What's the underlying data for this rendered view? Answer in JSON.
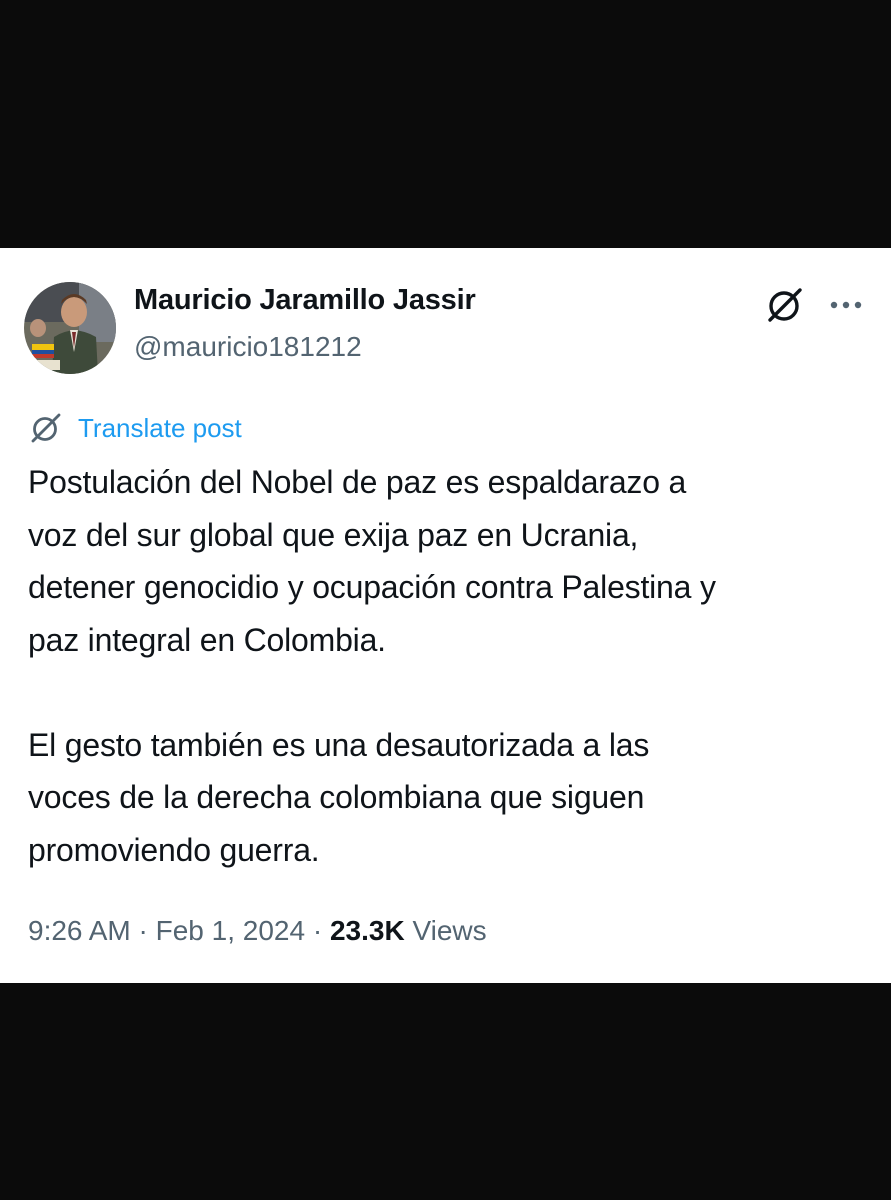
{
  "colors": {
    "background_band": "#0b0b0b",
    "card": "#ffffff",
    "text_primary": "#0f1419",
    "text_secondary": "#536471",
    "link_blue": "#1d9bf0"
  },
  "author": {
    "display_name": "Mauricio Jaramillo Jassir",
    "handle": "@mauricio181212",
    "avatar_icon": "profile-photo"
  },
  "actions": {
    "grok_icon": "grok-icon",
    "more_icon": "more-dots-icon"
  },
  "translate": {
    "icon": "grok-icon",
    "label": "Translate post"
  },
  "post": {
    "paragraph1": [
      "Postulación del Nobel de paz es espaldarazo a",
      "voz del sur global que exija paz en Ucrania,",
      "detener genocidio y ocupación contra Palestina y",
      "paz integral en Colombia."
    ],
    "paragraph2": [
      "El gesto también es una desautorizada a las",
      "voces de la derecha colombiana que siguen",
      "promoviendo guerra."
    ]
  },
  "meta": {
    "time": "9:26 AM",
    "separator": " · ",
    "date": "Feb 1, 2024",
    "views_count": "23.3K",
    "views_label": " Views"
  }
}
